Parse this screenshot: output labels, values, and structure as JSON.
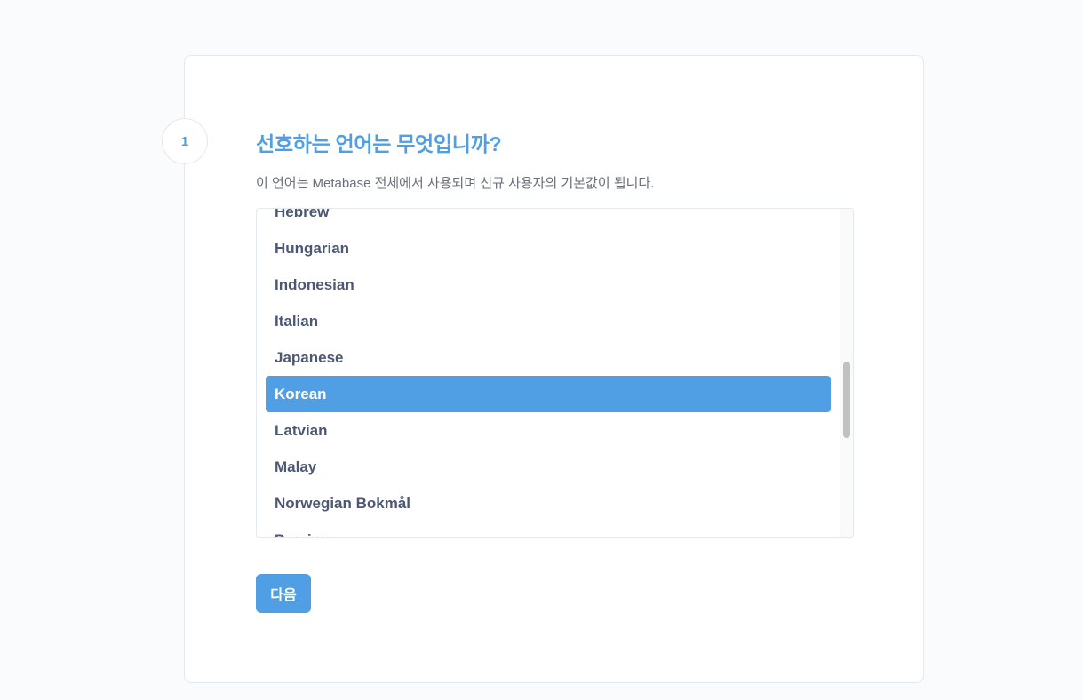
{
  "step": {
    "number": "1",
    "title": "선호하는 언어는 무엇입니까?",
    "description": "이 언어는 Metabase 전체에서 사용되며 신규 사용자의 기본값이 됩니다."
  },
  "language_list": {
    "items": [
      {
        "label": "Hebrew",
        "selected": false
      },
      {
        "label": "Hungarian",
        "selected": false
      },
      {
        "label": "Indonesian",
        "selected": false
      },
      {
        "label": "Italian",
        "selected": false
      },
      {
        "label": "Japanese",
        "selected": false
      },
      {
        "label": "Korean",
        "selected": true
      },
      {
        "label": "Latvian",
        "selected": false
      },
      {
        "label": "Malay",
        "selected": false
      },
      {
        "label": "Norwegian Bokmål",
        "selected": false
      },
      {
        "label": "Persian",
        "selected": false
      }
    ],
    "selected_value": "Korean"
  },
  "actions": {
    "next_label": "다음"
  },
  "colors": {
    "brand": "#509ee3",
    "text_dark": "#4c5773",
    "text_medium": "#696e7b",
    "border": "#e4e9ee",
    "page_background": "#f9fbfc"
  }
}
